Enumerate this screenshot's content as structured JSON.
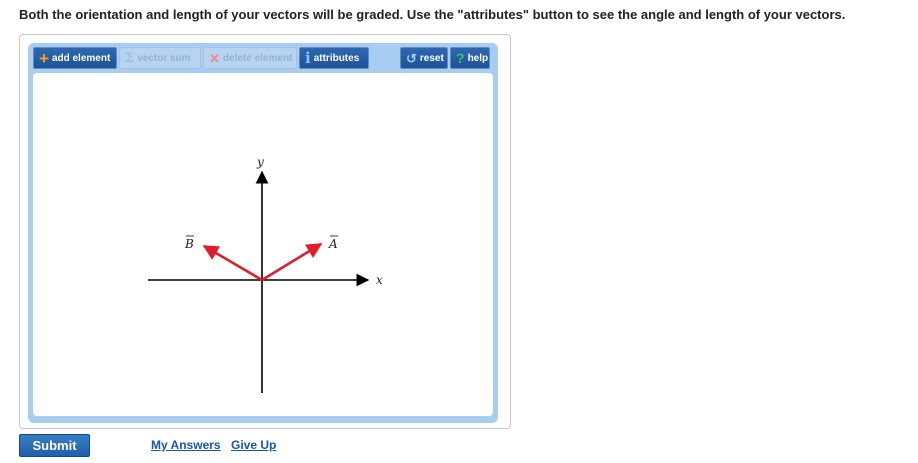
{
  "instructions": "Both the orientation and length of your vectors will be graded. Use the \"attributes\" button to see the angle and length of your vectors.",
  "toolbar": {
    "add_element": "add element",
    "vector_sum": "vector sum",
    "delete_element": "delete element",
    "attributes": "attributes",
    "reset": "reset",
    "help": "help"
  },
  "canvas": {
    "x_axis_label": "x",
    "y_axis_label": "y",
    "vectors": [
      {
        "label": "A",
        "color": "#e11d2b"
      },
      {
        "label": "B",
        "color": "#e11d2b"
      }
    ]
  },
  "actions": {
    "submit": "Submit",
    "my_answers": "My Answers",
    "give_up": "Give Up"
  },
  "colors": {
    "toolbar_button": "#2459a3",
    "panel_background": "#a9cdf0",
    "vector": "#e11d2b",
    "link": "#1a55a6"
  }
}
